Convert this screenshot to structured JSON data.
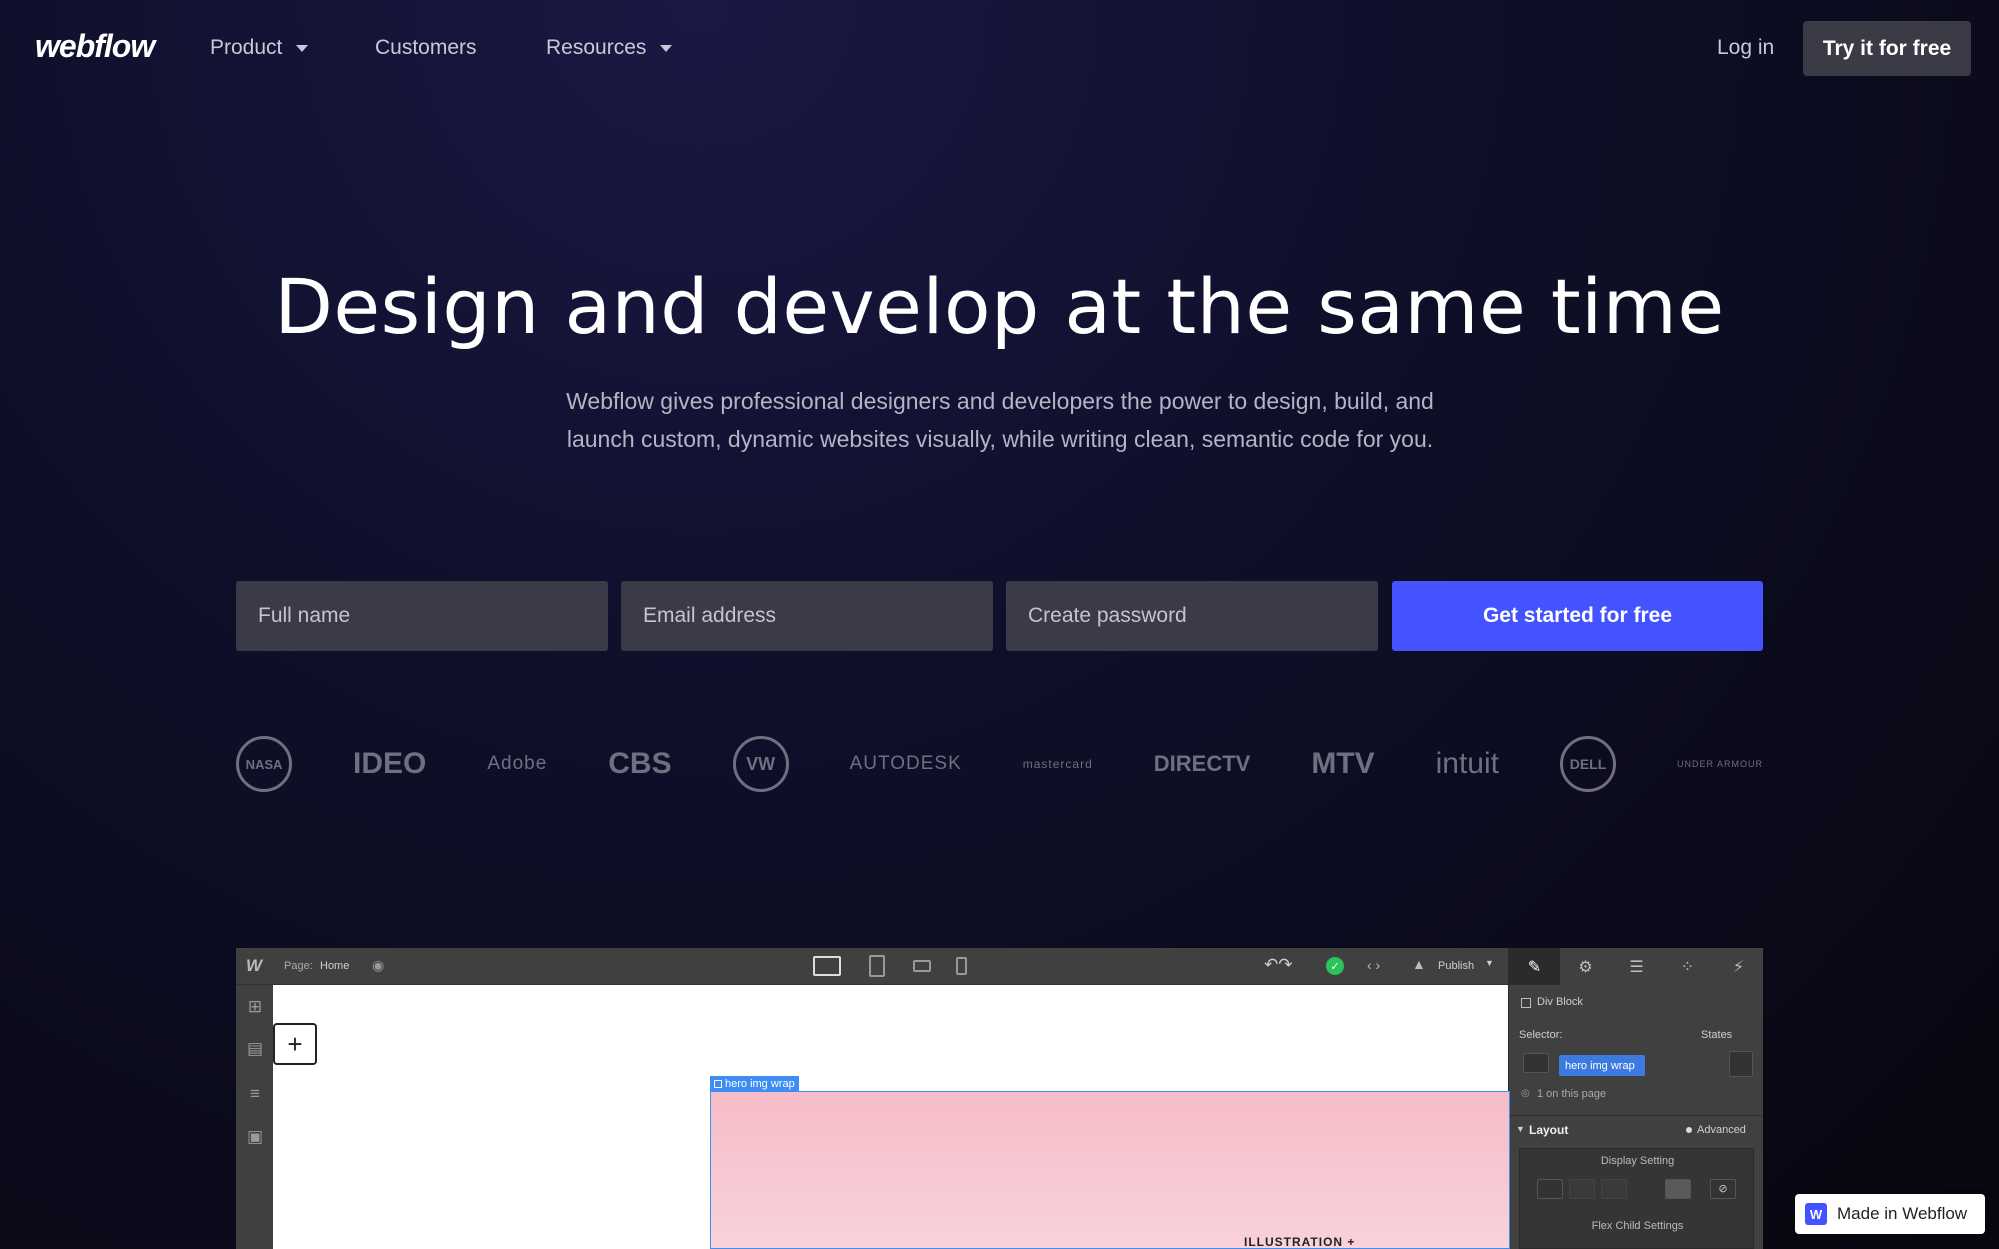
{
  "nav": {
    "logo": "webflow",
    "product": "Product",
    "customers": "Customers",
    "resources": "Resources",
    "login": "Log in",
    "try": "Try it for free"
  },
  "hero": {
    "title": "Design and develop at the same time",
    "subtitle_line1": "Webflow gives professional designers and developers the power to design, build, and",
    "subtitle_line2": "launch custom, dynamic websites visually, while writing clean, semantic code for you."
  },
  "signup": {
    "full_name_placeholder": "Full name",
    "email_placeholder": "Email address",
    "password_placeholder": "Create password",
    "submit": "Get started for free"
  },
  "logos": [
    "NASA",
    "IDEO",
    "Adobe",
    "CBS",
    "VW",
    "AUTODESK",
    "mastercard",
    "DIRECTV",
    "MTV",
    "intuit",
    "DELL",
    "UNDER ARMOUR"
  ],
  "designer": {
    "page_label": "Page:",
    "page_name": "Home",
    "publish": "Publish",
    "element_type": "Div Block",
    "selector_label": "Selector:",
    "states": "States",
    "class_name": "hero img wrap",
    "on_page": "1 on this page",
    "layout": "Layout",
    "advanced": "Advanced",
    "display_setting": "Display Setting",
    "flex_child": "Flex Child Settings",
    "selected_tag": "hero img wrap",
    "illustration": "ILLUSTRATION +"
  },
  "badge": "Made in Webflow",
  "colors": {
    "accent": "#4353ff",
    "selection": "#3d8df5"
  }
}
